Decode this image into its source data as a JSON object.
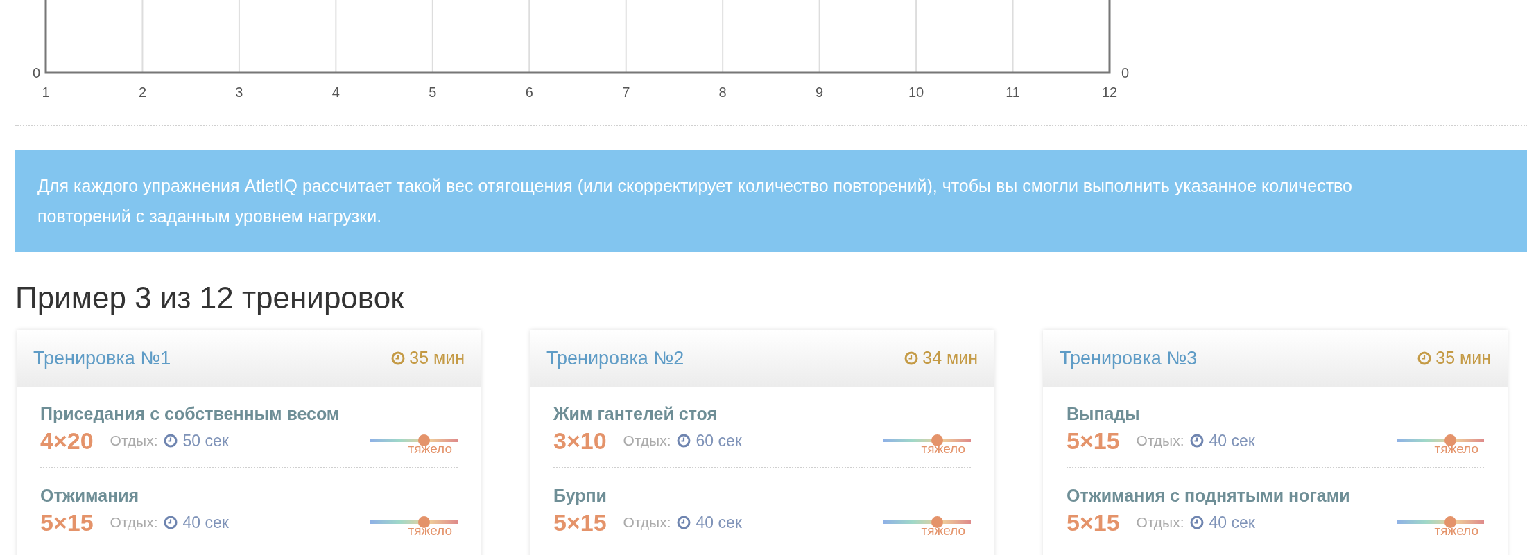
{
  "chart": {
    "x_axis_labels": [
      "1",
      "2",
      "3",
      "4",
      "5",
      "6",
      "7",
      "8",
      "9",
      "10",
      "11",
      "12"
    ],
    "left_axis_label": "0",
    "right_axis_label": "0"
  },
  "info_banner": {
    "text": "Для каждого упражнения AtletIQ рассчитает такой вес отягощения (или скорректирует количество повторений), чтобы вы смогли выполнить указанное количество повторений с заданным уровнем нагрузки."
  },
  "heading": "Пример 3 из 12 тренировок",
  "workouts": [
    {
      "title": "Тренировка №1",
      "duration": "35 мин",
      "exercises": [
        {
          "name": "Приседания с собственным весом",
          "sets": "4×20",
          "rest_label": "Отдых:",
          "rest": "50 сек",
          "intensity": {
            "level": 0.61,
            "label": "тяжело"
          }
        },
        {
          "name": "Отжимания",
          "sets": "5×15",
          "rest_label": "Отдых:",
          "rest": "40 сек",
          "intensity": {
            "level": 0.61,
            "label": "тяжело"
          }
        }
      ]
    },
    {
      "title": "Тренировка №2",
      "duration": "34 мин",
      "exercises": [
        {
          "name": "Жим гантелей стоя",
          "sets": "3×10",
          "rest_label": "Отдых:",
          "rest": "60 сек",
          "intensity": {
            "level": 0.61,
            "label": "тяжело"
          }
        },
        {
          "name": "Бурпи",
          "sets": "5×15",
          "rest_label": "Отдых:",
          "rest": "40 сек",
          "intensity": {
            "level": 0.61,
            "label": "тяжело"
          }
        }
      ]
    },
    {
      "title": "Тренировка №3",
      "duration": "35 мин",
      "exercises": [
        {
          "name": "Выпады",
          "sets": "5×15",
          "rest_label": "Отдых:",
          "rest": "40 сек",
          "intensity": {
            "level": 0.61,
            "label": "тяжело"
          }
        },
        {
          "name": "Отжимания с поднятыми ногами",
          "sets": "5×15",
          "rest_label": "Отдых:",
          "rest": "40 сек",
          "intensity": {
            "level": 0.61,
            "label": "тяжело"
          }
        }
      ]
    }
  ]
}
